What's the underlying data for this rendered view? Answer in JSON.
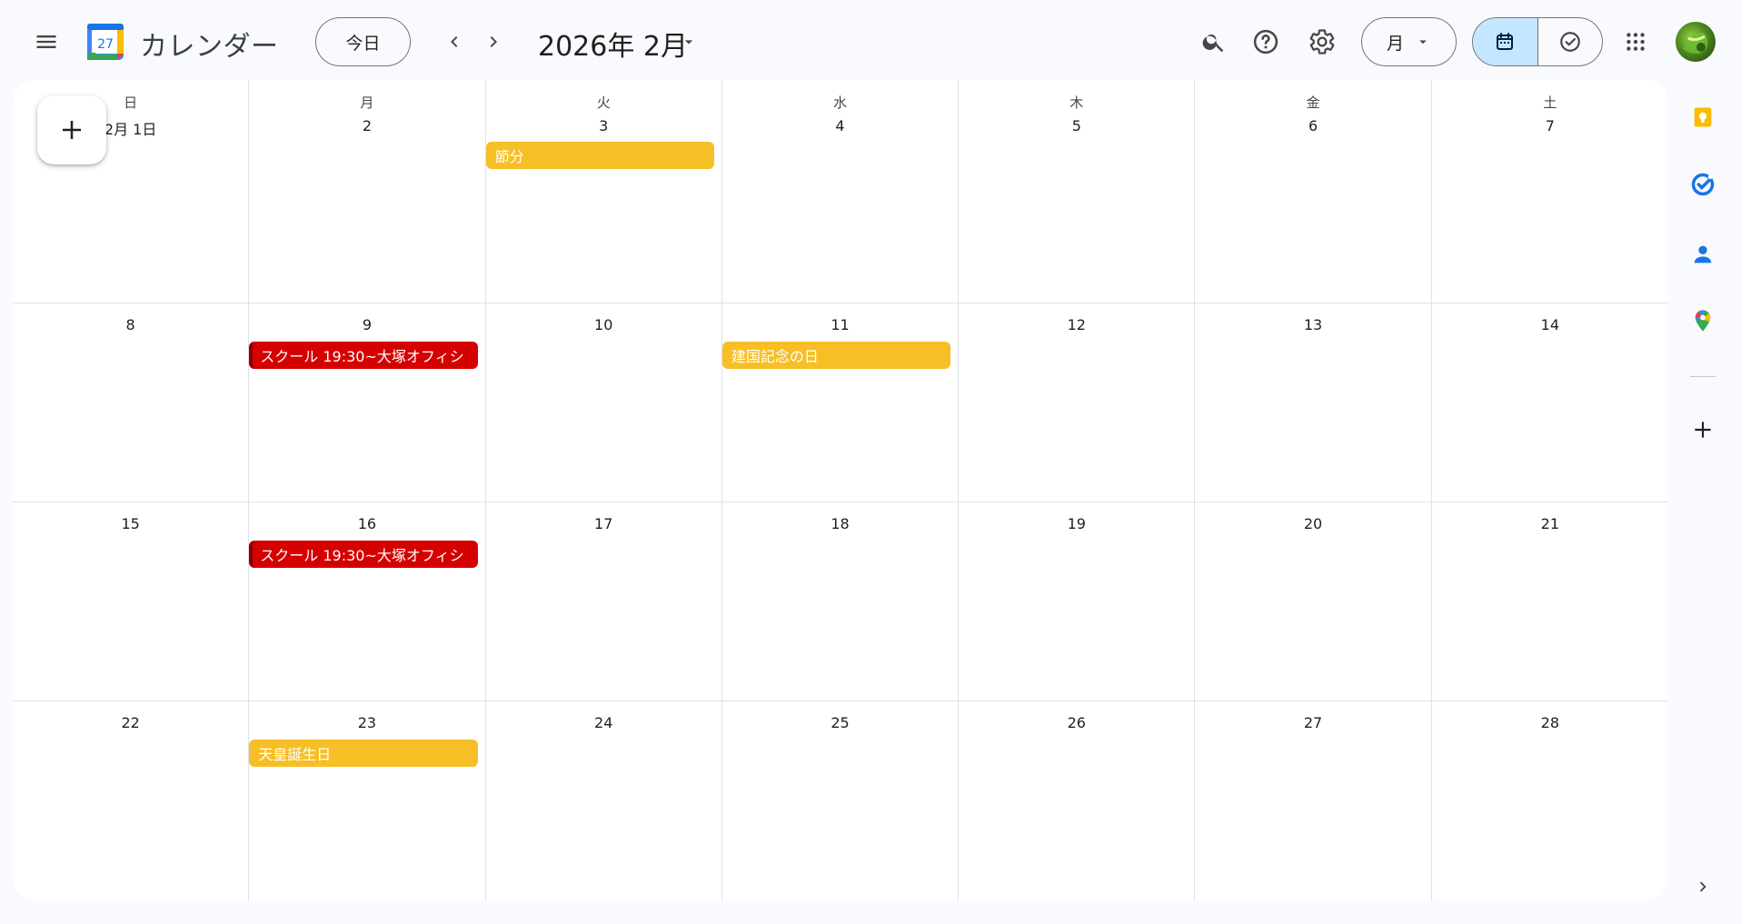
{
  "header": {
    "app_title": "カレンダー",
    "logo_day": "27",
    "today_label": "今日",
    "month_title": "2026年 2月",
    "view_label": "月"
  },
  "weekdays": [
    "日",
    "月",
    "火",
    "水",
    "木",
    "金",
    "土"
  ],
  "weeks": [
    {
      "days": [
        {
          "label": "2月 1日",
          "events": []
        },
        {
          "label": "2",
          "events": []
        },
        {
          "label": "3",
          "events": [
            {
              "title": "節分",
              "color": "yellow"
            }
          ]
        },
        {
          "label": "4",
          "events": []
        },
        {
          "label": "5",
          "events": []
        },
        {
          "label": "6",
          "events": []
        },
        {
          "label": "7",
          "events": []
        }
      ]
    },
    {
      "days": [
        {
          "label": "8",
          "events": []
        },
        {
          "label": "9",
          "events": [
            {
              "title": "スクール 19:30~大塚オフィシ",
              "color": "red"
            }
          ]
        },
        {
          "label": "10",
          "events": []
        },
        {
          "label": "11",
          "events": [
            {
              "title": "建国記念の日",
              "color": "yellow"
            }
          ]
        },
        {
          "label": "12",
          "events": []
        },
        {
          "label": "13",
          "events": []
        },
        {
          "label": "14",
          "events": []
        }
      ]
    },
    {
      "days": [
        {
          "label": "15",
          "events": []
        },
        {
          "label": "16",
          "events": [
            {
              "title": "スクール 19:30~大塚オフィシ",
              "color": "red"
            }
          ]
        },
        {
          "label": "17",
          "events": []
        },
        {
          "label": "18",
          "events": []
        },
        {
          "label": "19",
          "events": []
        },
        {
          "label": "20",
          "events": []
        },
        {
          "label": "21",
          "events": []
        }
      ]
    },
    {
      "days": [
        {
          "label": "22",
          "events": []
        },
        {
          "label": "23",
          "events": [
            {
              "title": "天皇誕生日",
              "color": "yellow"
            }
          ]
        },
        {
          "label": "24",
          "events": []
        },
        {
          "label": "25",
          "events": []
        },
        {
          "label": "26",
          "events": []
        },
        {
          "label": "27",
          "events": []
        },
        {
          "label": "28",
          "events": []
        }
      ]
    }
  ],
  "colors": {
    "yellow_event": "#f6bf26",
    "red_event": "#d50000",
    "active_toggle": "#c2e7ff",
    "background": "#f8fafd"
  },
  "side_panel": {
    "icons": [
      "keep-icon",
      "tasks-icon",
      "contacts-icon",
      "maps-icon",
      "add-icon",
      "chevron-right-icon"
    ]
  }
}
